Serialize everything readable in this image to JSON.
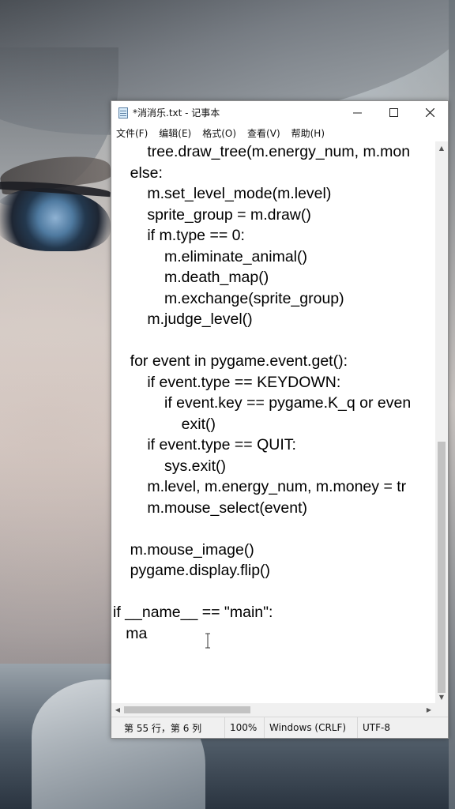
{
  "window": {
    "title": "*消消乐.txt - 记事本",
    "controls": {
      "minimize": "minimize",
      "maximize": "maximize",
      "close": "close"
    }
  },
  "menu": {
    "file": "文件(F)",
    "edit": "编辑(E)",
    "format": "格式(O)",
    "view": "查看(V)",
    "help": "帮助(H)"
  },
  "editor": {
    "lines": [
      "        tree.draw_tree(m.energy_num, m.mon",
      "    else:",
      "        m.set_level_mode(m.level)",
      "        sprite_group = m.draw()",
      "        if m.type == 0:",
      "            m.eliminate_animal()",
      "            m.death_map()",
      "            m.exchange(sprite_group)",
      "        m.judge_level()",
      "",
      "    for event in pygame.event.get():",
      "        if event.type == KEYDOWN:",
      "            if event.key == pygame.K_q or even",
      "                exit()",
      "        if event.type == QUIT:",
      "            sys.exit()",
      "        m.level, m.energy_num, m.money = tr",
      "        m.mouse_select(event)",
      "",
      "    m.mouse_image()",
      "    pygame.display.flip()",
      "",
      "if __name__ == \"main\":",
      "   ma"
    ]
  },
  "status": {
    "position": "第 55 行，第 6 列",
    "zoom": "100%",
    "line_ending": "Windows (CRLF)",
    "encoding": "UTF-8"
  }
}
